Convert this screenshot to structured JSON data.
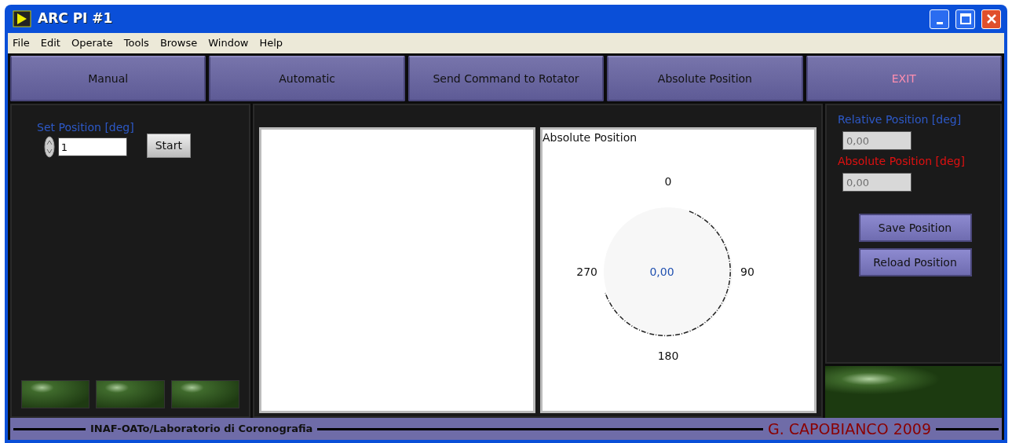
{
  "window": {
    "title": "ARC PI #1"
  },
  "menu": [
    "File",
    "Edit",
    "Operate",
    "Tools",
    "Browse",
    "Window",
    "Help"
  ],
  "toolbar": [
    {
      "label": "Manual",
      "disabled": false
    },
    {
      "label": "Automatic",
      "disabled": false
    },
    {
      "label": "Send Command to Rotator",
      "disabled": false
    },
    {
      "label": "Absolute Position",
      "disabled": false
    },
    {
      "label": "EXIT",
      "disabled": true
    }
  ],
  "left_panel": {
    "set_position": {
      "label": "Set Position [deg]",
      "value": "1"
    },
    "start_button": "Start",
    "leds": [
      {
        "on": false
      },
      {
        "on": false
      },
      {
        "on": false
      }
    ]
  },
  "dial": {
    "title": "Absolute Position",
    "reading": "0,00",
    "scale": [
      "0",
      "90",
      "180",
      "270"
    ]
  },
  "right_panel": {
    "relative": {
      "label": "Relative Position [deg]",
      "value": "0,00"
    },
    "absolute": {
      "label": "Absolute Position [deg]",
      "value": "0,00"
    },
    "buttons": [
      "Save Position",
      "Reload Position"
    ],
    "led": {
      "on": false
    }
  },
  "footer": {
    "left": "INAF-OATo/Laboratorio di Coronografia",
    "right": "G. CAPOBIANCO 2009"
  }
}
